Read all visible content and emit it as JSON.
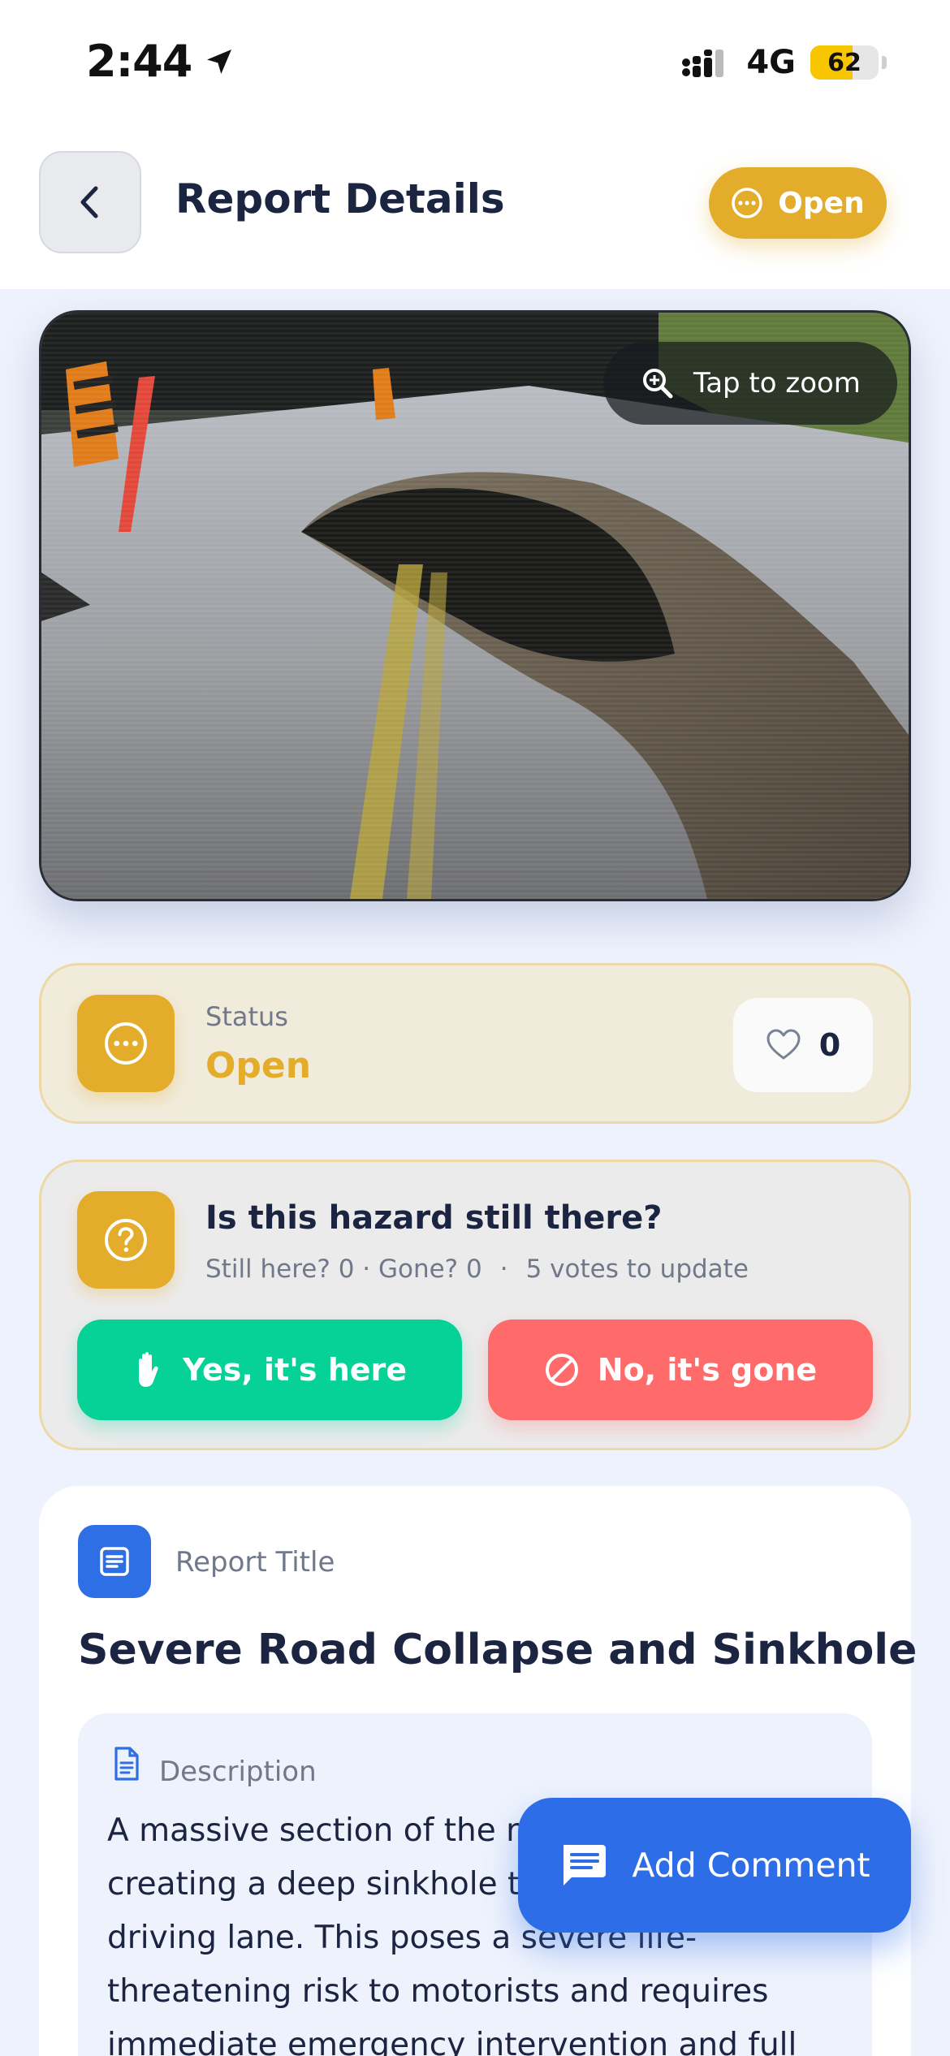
{
  "status_bar": {
    "time": "2:44",
    "network": "4G",
    "battery": "62",
    "battery_level": 0.62
  },
  "header": {
    "title": "Report Details",
    "status_badge": "Open"
  },
  "photo": {
    "zoom_hint": "Tap to zoom"
  },
  "status_card": {
    "label": "Status",
    "value": "Open",
    "likes": "0",
    "accent_color": "#e3ad2b"
  },
  "hazard_check": {
    "question": "Is this hazard still there?",
    "tally": "Still here? 0 · Gone? 0",
    "separator": "·",
    "votes_needed": "5 votes to update",
    "yes_label": "Yes, it's here",
    "no_label": "No, it's gone",
    "yes_color": "#06d196",
    "no_color": "#fe6b6a"
  },
  "report": {
    "title_label": "Report Title",
    "title": "Severe Road Collapse and Sinkhole",
    "description_label": "Description",
    "description": "A massive section of the road has collapsed, creating a deep sinkhole that swallows the driving lane. This poses a severe life-threatening risk to motorists and requires immediate emergency intervention and full"
  },
  "fab": {
    "label": "Add Comment",
    "color": "#2d6ee8"
  },
  "icons": {
    "back": "chevron-left-icon",
    "status": "more-horizontal-icon",
    "zoom": "zoom-in-icon",
    "like": "heart-icon",
    "hazard": "help-circle-icon",
    "yes": "hand-icon",
    "no": "block-icon",
    "doc": "document-icon",
    "comment": "comment-icon"
  }
}
